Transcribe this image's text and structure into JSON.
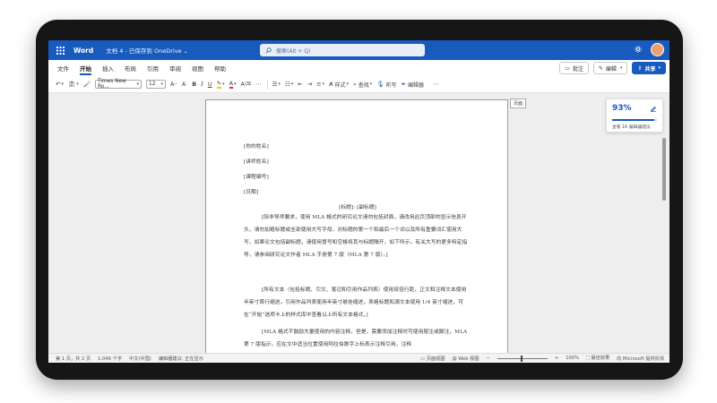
{
  "app": {
    "name": "Word",
    "document_title": "文档 4 - 已保存到 OneDrive",
    "search_placeholder": "搜索(Alt + Q)"
  },
  "ribbon": {
    "tabs": [
      {
        "label": "文件"
      },
      {
        "label": "开始",
        "active": true
      },
      {
        "label": "插入"
      },
      {
        "label": "布局"
      },
      {
        "label": "引用"
      },
      {
        "label": "审阅"
      },
      {
        "label": "视图"
      },
      {
        "label": "帮助"
      }
    ],
    "comments_label": "批注",
    "editing_label": "编辑",
    "share_label": "共享"
  },
  "toolbar": {
    "font_name": "Times New Ro...",
    "font_size": "12",
    "bold": "B",
    "italic": "I",
    "underline": "U",
    "styles_label": "样式",
    "find_label": "查找",
    "dictate_label": "听写",
    "editor_label": "编辑器"
  },
  "document": {
    "page_label": "页面",
    "header_lines": [
      "[你的姓名]",
      "[讲师姓名]",
      "[课程编号]",
      "[日期]"
    ],
    "title": "[标题]: [副标题]",
    "paragraphs": [
      "[除非导师要求，使用 MLA 格式的研究论文请勿包括封面，请改用此页顶部的显示信息开头，请勿加粗标题或全部使用大写字母，对标题的第一个和最后一个词以及所有重要词汇使用大写，如果论文包括副标题，请使用冒号和空格将其与标题隔开，如下所示，有关大写的更多特定指导，请参阅研究论文作者 MLA 手册第 7 版（MLA 第 7 版）。]",
      "[所有文本（包括标题、引文、笔记和引用作品列表）使用双倍行距，正文和注释文本使用半英寸首行缩进，引用作品列表使用半英寸悬挂缩进，表格标题和源文本使用 1/4 英寸缩进，可在“开始”选项卡上的样式库中查看以上所有文本格式。]",
      "[MLA 格式不鼓励大量使用的内容注释，但是，需要添加注释时可使用尾注或脚注，MLA 第 7 版指示，应在文中适当位置使用阿拉伯数字上标表示注释引用，注释"
    ]
  },
  "editor_pane": {
    "score": "93%",
    "score_value": 93,
    "suggestions": "查看 16 编辑器建议"
  },
  "status": {
    "page": "第 1 页，共 2 页",
    "words": "1,046 个字",
    "language": "中文(中国)",
    "suggestions": "编辑器建议: 正在显示",
    "view_page": "页面视图",
    "view_web": "Web 视图",
    "zoom": "100%",
    "feedback": "最佳效果",
    "improve": "向 Microsoft 提供反馈"
  },
  "colors": {
    "brand": "#185abd",
    "highlight": "#f0d000",
    "font_color": "#d03030"
  }
}
